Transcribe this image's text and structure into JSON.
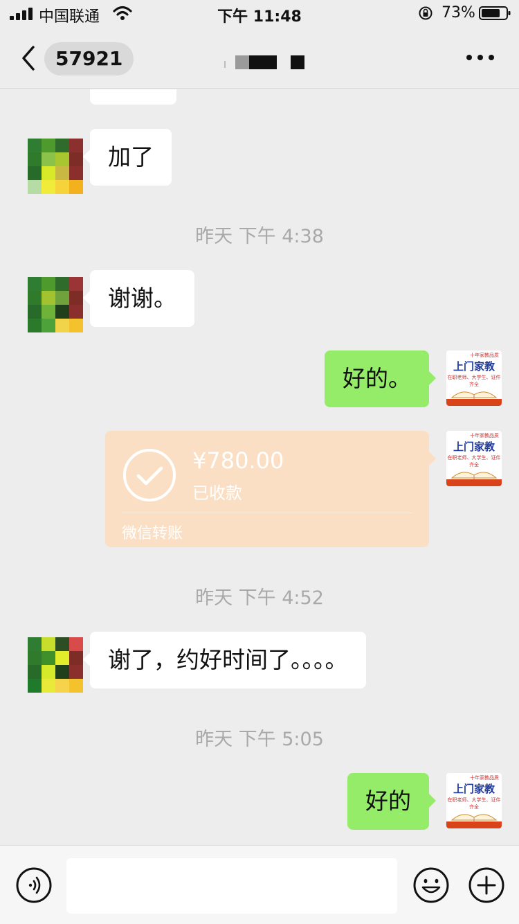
{
  "status_bar": {
    "carrier": "中国联通",
    "time": "下午 11:48",
    "battery_percent": "73%",
    "icons": [
      "signal-icon",
      "wifi-icon",
      "orientation-lock-icon",
      "battery-icon"
    ]
  },
  "nav": {
    "unread_count": "57921",
    "icons": [
      "back-arrow-icon",
      "more-icon"
    ]
  },
  "messages": [
    {
      "type": "text",
      "side": "left",
      "text": "加了"
    },
    {
      "type": "time",
      "text": "昨天 下午 4:38"
    },
    {
      "type": "text",
      "side": "left",
      "text": "谢谢。"
    },
    {
      "type": "text",
      "side": "right",
      "text": "好的。"
    },
    {
      "type": "transfer",
      "side": "right",
      "amount": "¥780.00",
      "status": "已收款",
      "footer": "微信转账"
    },
    {
      "type": "time",
      "text": "昨天 下午 4:52"
    },
    {
      "type": "text",
      "side": "left",
      "text": "谢了，约好时间了。。。。"
    },
    {
      "type": "time",
      "text": "昨天 下午 5:05"
    },
    {
      "type": "text",
      "side": "right",
      "text": "好的"
    }
  ],
  "avatar_logo": {
    "top_text": "十年家教品质",
    "title": "上门家教",
    "subtitle": "在职老师、大学生、证件齐全"
  },
  "colors": {
    "background": "#ededed",
    "bubble_self": "#95ec69",
    "bubble_other": "#ffffff",
    "transfer_received": "#fbdfc4",
    "timestamp": "#a9a9a9"
  },
  "input_bar": {
    "icons": [
      "voice-icon",
      "emoji-icon",
      "plus-icon"
    ]
  }
}
